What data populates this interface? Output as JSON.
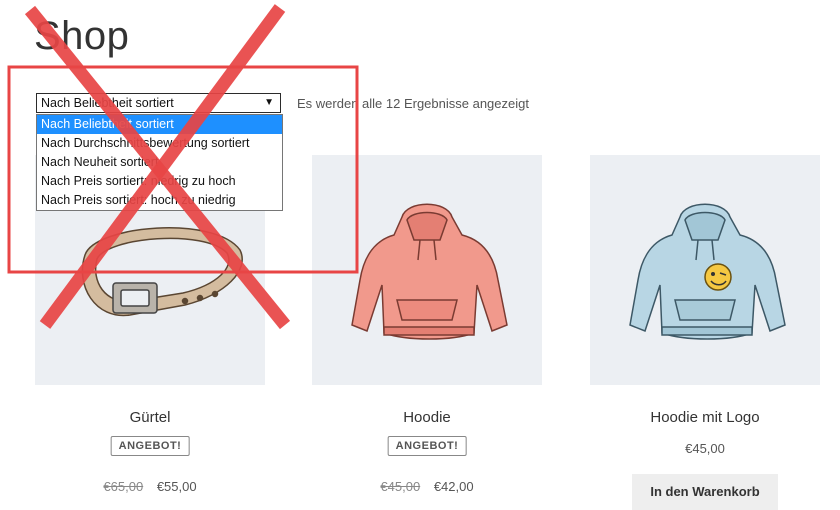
{
  "page": {
    "title": "Shop",
    "result_count": "Es werden alle 12 Ergebnisse angezeigt"
  },
  "sort": {
    "selected": "Nach Beliebtheit sortiert",
    "arrow_icon": "triangle-down-icon",
    "options": [
      "Nach Beliebtheit sortiert",
      "Nach Durchschnittsbewertung sortiert",
      "Nach Neuheit sortiert",
      "Nach Preis sortiert: niedrig zu hoch",
      "Nach Preis sortiert: hoch zu niedrig"
    ]
  },
  "products": [
    {
      "name": "Gürtel",
      "badge": "ANGEBOT!",
      "price_old": "€65,00",
      "price_new": "€55,00",
      "image": "belt-image"
    },
    {
      "name": "Hoodie",
      "badge": "ANGEBOT!",
      "price_old": "€45,00",
      "price_new": "€42,00",
      "image": "hoodie-image"
    },
    {
      "name": "Hoodie mit Logo",
      "price": "€45,00",
      "button_label": "In den Warenkorb",
      "image": "hoodie-logo-image"
    }
  ],
  "colors": {
    "annotation_red": "#e84545",
    "selected_option_bg": "#1e90ff",
    "image_bg": "#eceff3"
  }
}
